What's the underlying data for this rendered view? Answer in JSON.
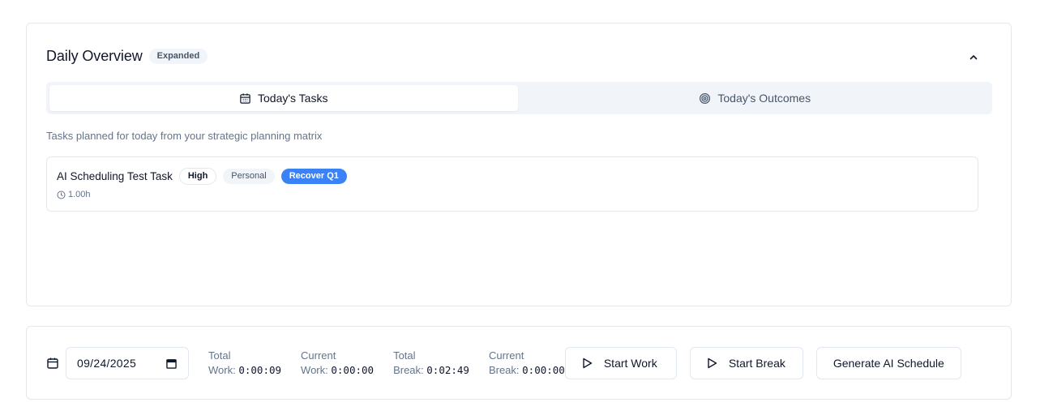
{
  "overview": {
    "title": "Daily Overview",
    "state_badge": "Expanded",
    "tabs": [
      {
        "label": "Today's Tasks",
        "icon": "calendar-icon",
        "active": true
      },
      {
        "label": "Today's Outcomes",
        "icon": "target-icon",
        "active": false
      }
    ],
    "description": "Tasks planned for today from your strategic planning matrix",
    "tasks": [
      {
        "title": "AI Scheduling Test Task",
        "priority": "High",
        "category": "Personal",
        "goal": "Recover Q1",
        "duration": "1.00h"
      }
    ]
  },
  "tracker": {
    "date": "09/24/2025",
    "stats": [
      {
        "label_line1": "Total",
        "label_line2": "Work:",
        "value": "0:00:09"
      },
      {
        "label_line1": "Current",
        "label_line2": "Work:",
        "value": "0:00:00"
      },
      {
        "label_line1": "Total",
        "label_line2": "Break:",
        "value": "0:02:49"
      },
      {
        "label_line1": "Current",
        "label_line2": "Break:",
        "value": "0:00:00"
      }
    ],
    "start_work_label": "Start Work",
    "start_break_label": "Start Break",
    "generate_label": "Generate AI Schedule"
  },
  "colors": {
    "goal_pill": "#3b82f6",
    "border": "#e5e7eb",
    "muted_text": "#64748b"
  }
}
